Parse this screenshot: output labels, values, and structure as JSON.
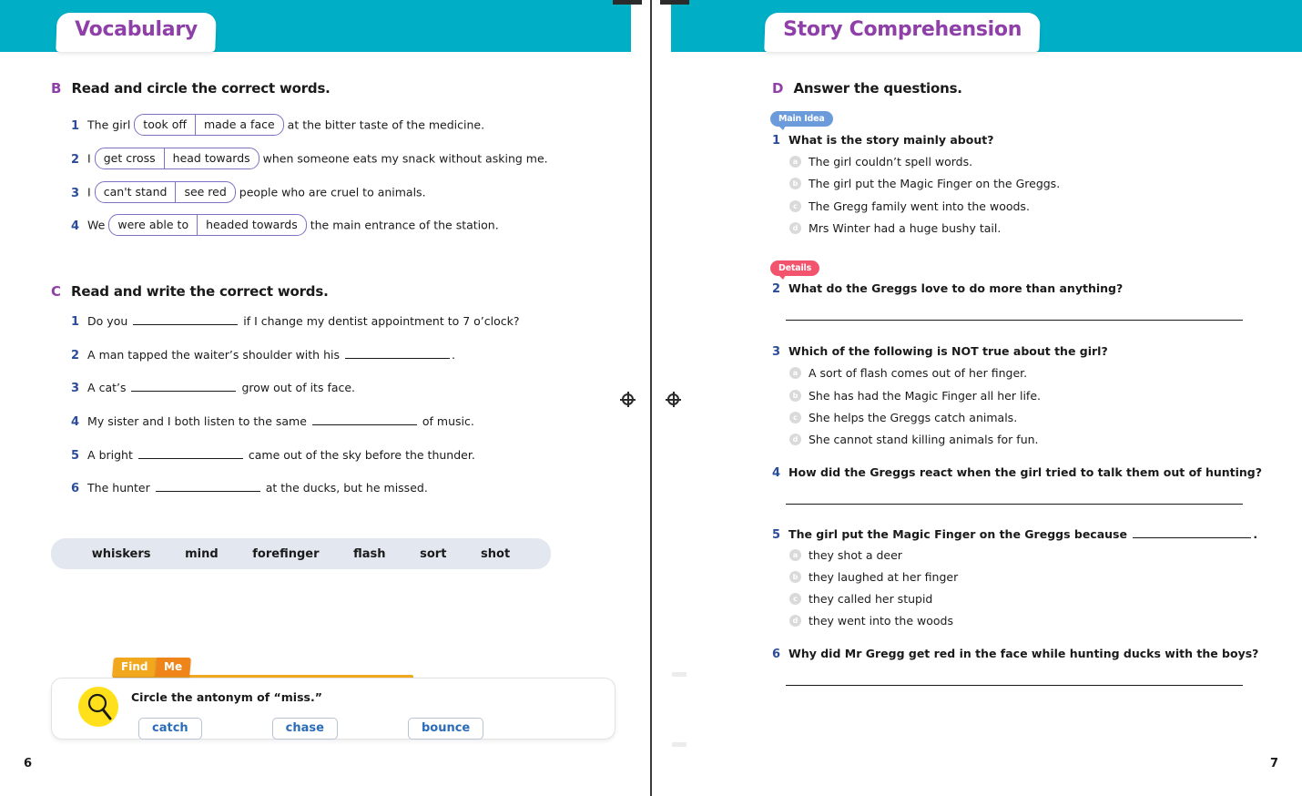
{
  "left_page": {
    "number": "6",
    "tab_title": "Vocabulary",
    "section_b": {
      "letter": "B",
      "title": "Read and circle the correct words.",
      "items": [
        {
          "num": "1",
          "before": "The girl",
          "opt1": "took off",
          "opt2": "made a face",
          "after": "at the bitter taste of the medicine."
        },
        {
          "num": "2",
          "before": "I",
          "opt1": "get cross",
          "opt2": "head towards",
          "after": "when someone eats my snack without asking me."
        },
        {
          "num": "3",
          "before": "I",
          "opt1": "can't stand",
          "opt2": "see red",
          "after": "people who are cruel to animals."
        },
        {
          "num": "4",
          "before": "We",
          "opt1": "were able to",
          "opt2": "headed towards",
          "after": "the main entrance of the station."
        }
      ]
    },
    "section_c": {
      "letter": "C",
      "title": "Read and write the correct words.",
      "items": [
        {
          "num": "1",
          "before": "Do you",
          "after": "if I change my dentist appointment to 7 o’clock?"
        },
        {
          "num": "2",
          "before": "A man tapped the waiter’s shoulder with his",
          "after": "."
        },
        {
          "num": "3",
          "before": "A cat’s",
          "after": "grow out of its face."
        },
        {
          "num": "4",
          "before": "My sister and I both listen to the same",
          "after": "of music."
        },
        {
          "num": "5",
          "before": "A bright",
          "after": "came out of the sky before the thunder."
        },
        {
          "num": "6",
          "before": "The hunter",
          "after": "at the ducks, but he missed."
        }
      ],
      "word_bank": [
        "whiskers",
        "mind",
        "forefinger",
        "flash",
        "sort",
        "shot"
      ]
    },
    "find_me": {
      "tab_1": "Find",
      "tab_2": "Me",
      "icon": "magnifier-icon",
      "prompt": "Circle the antonym of “miss.”",
      "options": [
        "catch",
        "chase",
        "bounce"
      ]
    }
  },
  "right_page": {
    "number": "7",
    "tab_title": "Story Comprehension",
    "section_d": {
      "letter": "D",
      "title": "Answer the questions.",
      "badges": {
        "main_idea": "Main Idea",
        "details": "Details"
      },
      "questions": [
        {
          "num": "1",
          "text": "What is the story mainly about?",
          "type": "multiple-choice",
          "options": [
            {
              "marker": "a",
              "text": "The girl couldn’t spell words."
            },
            {
              "marker": "b",
              "text": "The girl put the Magic Finger on the Greggs."
            },
            {
              "marker": "c",
              "text": "The Gregg family went into the woods."
            },
            {
              "marker": "d",
              "text": "Mrs Winter had a huge bushy tail."
            }
          ]
        },
        {
          "num": "2",
          "text": "What do the Greggs love to do more than anything?",
          "type": "open-ended",
          "options": []
        },
        {
          "num": "3",
          "text": "Which of the following is NOT true about the girl?",
          "type": "multiple-choice",
          "options": [
            {
              "marker": "a",
              "text": "A sort of flash comes out of her finger."
            },
            {
              "marker": "b",
              "text": "She has had the Magic Finger all her life."
            },
            {
              "marker": "c",
              "text": "She helps the Greggs catch animals."
            },
            {
              "marker": "d",
              "text": "She cannot stand killing animals for fun."
            }
          ]
        },
        {
          "num": "4",
          "text": "How did the Greggs react when the girl tried to talk them out of hunting?",
          "type": "open-ended",
          "options": []
        },
        {
          "num": "5",
          "text": "The girl put the Magic Finger on the Greggs because",
          "text_after": ".",
          "type": "multiple-choice-blank",
          "options": [
            {
              "marker": "a",
              "text": "they shot a deer"
            },
            {
              "marker": "b",
              "text": "they laughed at her finger"
            },
            {
              "marker": "c",
              "text": "they called her stupid"
            },
            {
              "marker": "d",
              "text": "they went into the woods"
            }
          ]
        },
        {
          "num": "6",
          "text": "Why did Mr Gregg get red in the face while hunting ducks with the boys?",
          "type": "open-ended",
          "options": []
        }
      ]
    }
  },
  "colors": {
    "header_teal": "#00AFC6",
    "tab_purple": "#8E3FA8",
    "number_blue": "#2B4C9B",
    "choice_border": "#7B72C4",
    "wordbank_bg": "#E3E8F0",
    "badge_main": "#6C9BDB",
    "badge_details": "#F2546E",
    "findme_orange": "#F2A81E",
    "findme_orange_dark": "#EF8518",
    "magnifier_yellow": "#FFE01B",
    "findme_option_blue": "#2B6CB8"
  }
}
